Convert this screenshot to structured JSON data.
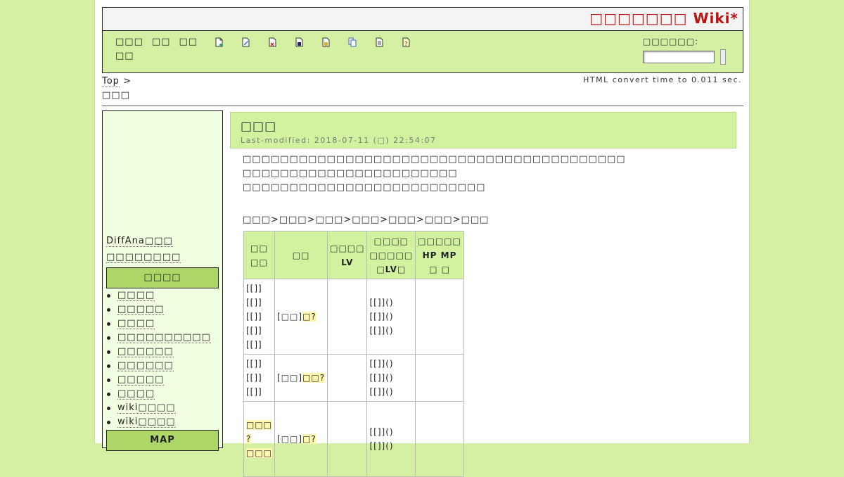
{
  "header": {
    "site_title": "□□□□□□□ Wiki*"
  },
  "nav": {
    "links_row1": [
      "□□□",
      "□□",
      "□□"
    ],
    "links_row2": [
      "□□"
    ],
    "tool_icons": [
      "new-page-icon",
      "edit-icon",
      "diff-icon",
      "backup-icon",
      "freeze-icon",
      "copy-icon",
      "list-icon",
      "help-icon"
    ]
  },
  "search": {
    "label": "□□□□□□:"
  },
  "breadcrumb": {
    "top": "Top",
    "sep": ">",
    "current": "□□□"
  },
  "convert_time": "HTML convert time to 0.011 sec.",
  "sidebar": {
    "text1": "DiffAna□□□",
    "text2": "□□□□□□□□",
    "heading1": "□□□□",
    "items": [
      "□□□□",
      "□□□□□",
      "□□□□",
      "□□□□□□□□□□",
      "□□□□□□",
      "□□□□□□",
      "□□□□□",
      "□□□□",
      "wiki□□□□",
      "wiki□□□□"
    ],
    "heading2": "MAP"
  },
  "main": {
    "title": "□□□",
    "last_modified": "Last-modified: 2018-07-11 (□) 22:54:07",
    "paragraphs": [
      "□□□□□□□□□□□□□□□□□□□□□□□□□□□□□□□□□□□□□□□□□",
      "□□□□□□□□□□□□□□□□□□□□□□□",
      "□□□□□□□□□□□□□□□□□□□□□□□□□□"
    ],
    "chain": "□□□>□□□>□□□>□□□>□□□>□□□>□□□"
  },
  "table": {
    "headers": [
      "□□\n□□",
      "□□",
      "□□□□\nLV",
      "□□□□\n□□□□□\n□LV□",
      "□□□□□\nHP MP □ □"
    ],
    "rows": [
      {
        "c0": [
          "[[]]",
          "[[]]",
          "[[]]",
          "[[]]",
          "[[]]"
        ],
        "c1_prefix": "[□□]",
        "c1_link": "□?",
        "c3": [
          "[[]]()",
          "[[]]()",
          "[[]]()"
        ]
      },
      {
        "c0": [
          "[[]]",
          "[[]]",
          "[[]]"
        ],
        "c1_prefix": "[□□]",
        "c1_link": "□□?",
        "c3": [
          "[[]]()",
          "[[]]()",
          "[[]]()"
        ]
      },
      {
        "c0": [
          "□□□",
          "?",
          "□□□"
        ],
        "c1_prefix": "[□□]",
        "c1_link": "□?",
        "c3": [
          "[[]]()",
          "[[]]()"
        ]
      }
    ]
  }
}
